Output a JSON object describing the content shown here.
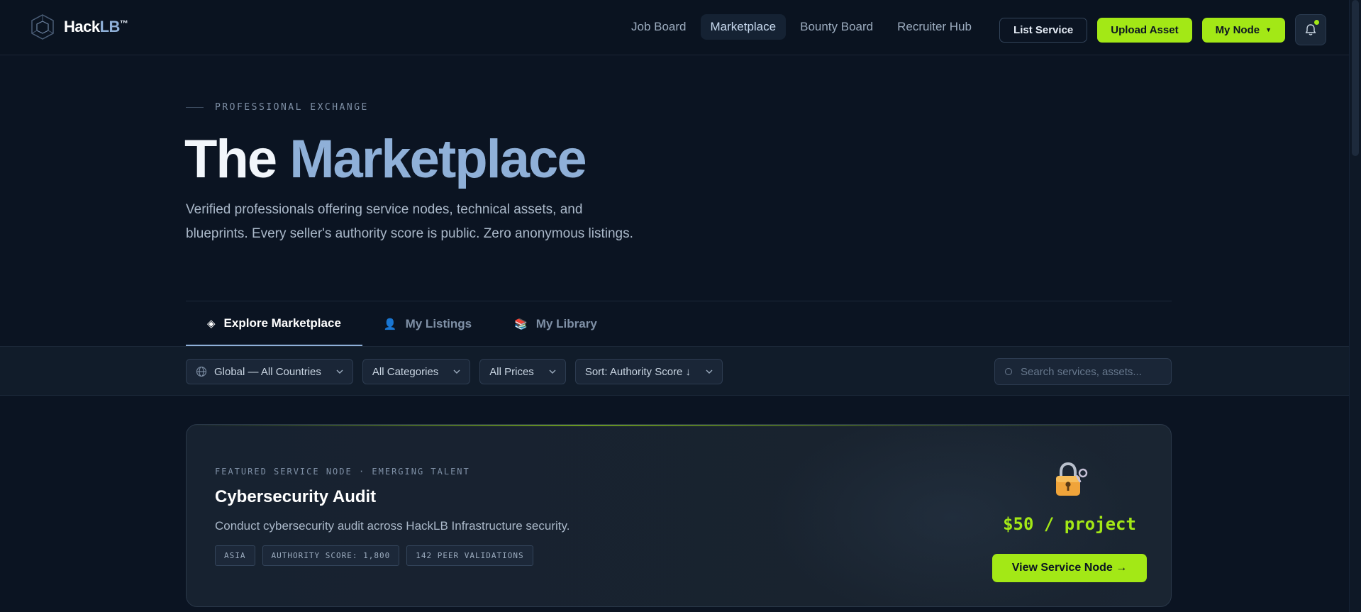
{
  "brand": {
    "name_a": "Hack",
    "name_b": "LB",
    "tm": "™"
  },
  "nav": {
    "items": [
      {
        "label": "Job Board"
      },
      {
        "label": "Marketplace"
      },
      {
        "label": "Bounty Board"
      },
      {
        "label": "Recruiter Hub"
      }
    ]
  },
  "actions": {
    "list_service": "List Service",
    "upload_asset": "Upload Asset",
    "my_node": "My Node"
  },
  "hero": {
    "eyebrow": "PROFESSIONAL EXCHANGE",
    "title_a": "The",
    "title_b": "Marketplace",
    "subtitle": "Verified professionals offering service nodes, technical assets, and blueprints. Every seller's authority score is public. Zero anonymous listings."
  },
  "tabs": [
    {
      "label": "Explore Marketplace",
      "icon": "diamond-icon"
    },
    {
      "label": "My Listings",
      "icon": "person-icon"
    },
    {
      "label": "My Library",
      "icon": "books-icon"
    }
  ],
  "filters": {
    "country": "Global — All Countries",
    "category": "All Categories",
    "price": "All Prices",
    "sort": "Sort: Authority Score ↓",
    "search_placeholder": "Search services, assets..."
  },
  "featured": {
    "eyebrow": "FEATURED SERVICE NODE · EMERGING TALENT",
    "title": "Cybersecurity Audit",
    "description": "Conduct cybersecurity audit across HackLB Infrastructure security.",
    "tags": [
      "ASIA",
      "AUTHORITY SCORE: 1,800",
      "142 PEER VALIDATIONS"
    ],
    "price": "$50 / project",
    "cta": "View Service Node →",
    "icon": "lock-key-icon"
  },
  "colors": {
    "accent": "#a3e816",
    "brand": "#8fb0d8",
    "background": "#0b1422"
  }
}
